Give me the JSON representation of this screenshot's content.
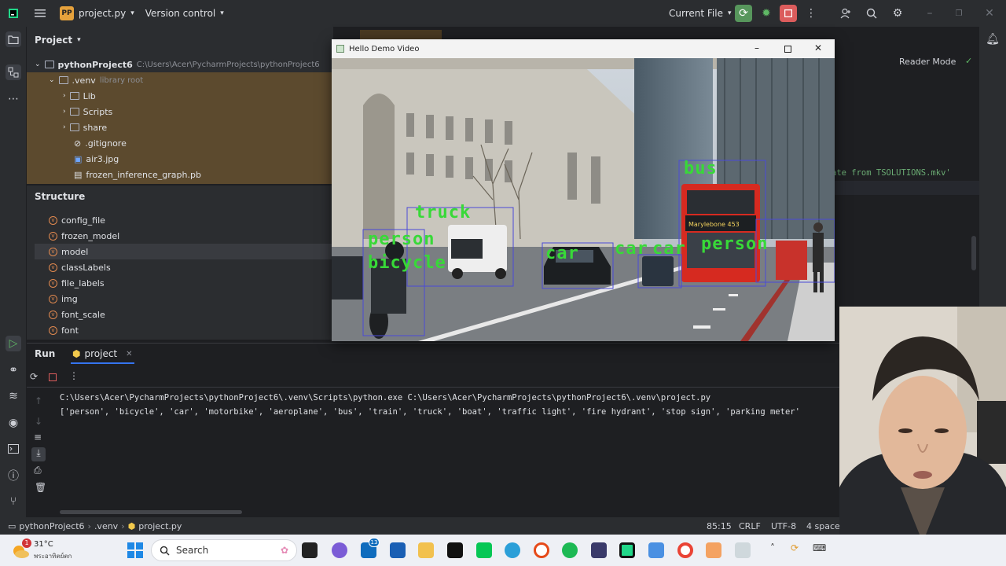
{
  "titlebar": {
    "project_badge": "PP",
    "project_name": "project.py",
    "vcs": "Version control",
    "run_config": "Current File"
  },
  "project_panel": {
    "title": "Project",
    "root": "pythonProject6",
    "root_path": "C:\\Users\\Acer\\PycharmProjects\\pythonProject6",
    "items": [
      {
        "label": ".venv",
        "note": "library root"
      },
      {
        "label": "Lib"
      },
      {
        "label": "Scripts"
      },
      {
        "label": "share"
      },
      {
        "label": ".gitignore"
      },
      {
        "label": "air3.jpg"
      },
      {
        "label": "frozen_inference_graph.pb"
      }
    ]
  },
  "structure_panel": {
    "title": "Structure",
    "items": [
      "config_file",
      "frozen_model",
      "model",
      "classLabels",
      "file_labels",
      "img",
      "font_scale",
      "font"
    ]
  },
  "editor": {
    "reader_mode": "Reader Mode",
    "code_fragment": "ate from TSOLUTIONS.mkv'"
  },
  "run_panel": {
    "tab_run": "Run",
    "tab_project": "project",
    "lines": [
      "C:\\Users\\Acer\\PycharmProjects\\pythonProject6\\.venv\\Scripts\\python.exe C:\\Users\\Acer\\PycharmProjects\\pythonProject6\\.venv\\project.py",
      "['person', 'bicycle', 'car', 'motorbike', 'aeroplane', 'bus', 'train', 'truck', 'boat', 'traffic light', 'fire hydrant', 'stop sign', 'parking meter'"
    ]
  },
  "statusbar": {
    "crumbs": [
      "pythonProject6",
      ".venv",
      "project.py"
    ],
    "position": "85:15",
    "line_sep": "CRLF",
    "encoding": "UTF-8",
    "indent": "4 space"
  },
  "video_window": {
    "title": "Hello Demo Video",
    "detections": [
      "truck",
      "person",
      "bicycle",
      "car",
      "car",
      "car",
      "person",
      "bus"
    ],
    "bus_sign": "Marylebone 453"
  },
  "taskbar": {
    "weather_temp": "31°C",
    "weather_desc": "พระอาทิตย์ตก",
    "search": "Search",
    "weather_badge": "1",
    "mail_badge": "13"
  }
}
